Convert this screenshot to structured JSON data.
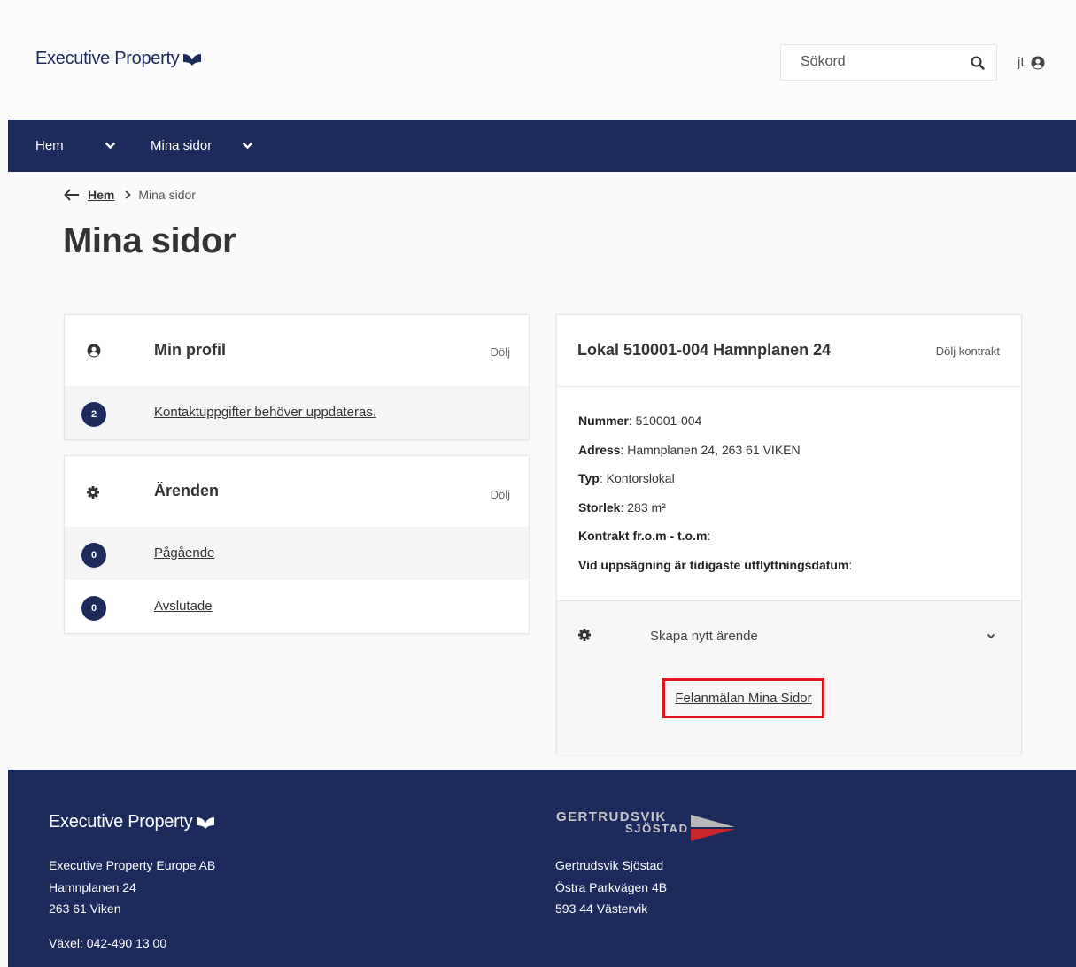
{
  "brand": {
    "name": "Executive Property",
    "color": "#1c2a5c"
  },
  "header": {
    "search_placeholder": "Sökord",
    "user_initials": "jL"
  },
  "nav": {
    "items": [
      {
        "label": "Hem"
      },
      {
        "label": "Mina sidor"
      }
    ]
  },
  "breadcrumb": {
    "home": "Hem",
    "current": "Mina sidor"
  },
  "page_title": "Mina sidor",
  "profile_card": {
    "title": "Min profil",
    "hide_label": "Dölj",
    "rows": [
      {
        "count": "2",
        "label": "Kontaktuppgifter behöver uppdateras."
      }
    ]
  },
  "cases_card": {
    "title": "Ärenden",
    "hide_label": "Dölj",
    "rows": [
      {
        "count": "0",
        "label": "Pågående"
      },
      {
        "count": "0",
        "label": "Avslutade"
      }
    ]
  },
  "contract_card": {
    "title": "Lokal 510001-004 Hamnplanen 24",
    "hide_label": "Dölj kontrakt",
    "fields": [
      {
        "label": "Nummer",
        "value": ": 510001-004"
      },
      {
        "label": "Adress",
        "value": ": Hamnplanen 24, 263 61 VIKEN"
      },
      {
        "label": "Typ",
        "value": ": Kontorslokal"
      },
      {
        "label": "Storlek",
        "value": ": 283 m²"
      },
      {
        "label": "Kontrakt fr.o.m - t.o.m",
        "value": ":"
      },
      {
        "label": "Vid uppsägning är tidigaste utflyttningsdatum",
        "value": ":"
      }
    ],
    "new_case_label": "Skapa nytt ärende",
    "report_link": "Felanmälan Mina Sidor",
    "highlight_color": "#e0141e"
  },
  "footer": {
    "company": {
      "name": "Executive Property Europe AB",
      "street": "Hamnplanen 24",
      "city": "263 61 Viken",
      "phone": "Växel: 042-490 13 00"
    },
    "partner": {
      "logo_line1": "GERTRUDSVIK",
      "logo_line2": "SJÖSTAD",
      "name": "Gertrudsvik Sjöstad",
      "street": "Östra Parkvägen 4B",
      "city": "593 44 Västervik"
    }
  }
}
